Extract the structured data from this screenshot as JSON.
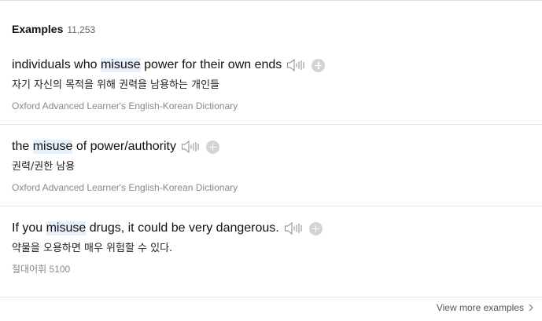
{
  "header": {
    "title": "Examples",
    "count": "11,253"
  },
  "examples": [
    {
      "pre": "individuals who ",
      "term": "misuse",
      "post": " power for their own ends",
      "translation": "자기 자신의 목적을 위해 권력을 남용하는 개인들",
      "source": "Oxford Advanced Learner's English-Korean Dictionary",
      "speaker_icon": "speaker-icon",
      "add_icon": "plus-circle-icon"
    },
    {
      "pre": "the ",
      "term": "misuse",
      "post": " of power/authority",
      "translation": "권력/권한 남용",
      "source": "Oxford Advanced Learner's English-Korean Dictionary",
      "speaker_icon": "speaker-icon",
      "add_icon": "plus-circle-icon"
    },
    {
      "pre": "If you ",
      "term": "misuse",
      "post": " drugs, it could be very dangerous.",
      "translation": "약물을 오용하면 매우 위험할 수 있다.",
      "source": "절대어휘 5100",
      "speaker_icon": "speaker-icon",
      "add_icon": "plus-circle-icon"
    }
  ],
  "footer": {
    "more_label": "View more examples"
  },
  "colors": {
    "highlight": "#e5f0fb",
    "muted": "#888888",
    "icon": "#cfcfcf"
  }
}
